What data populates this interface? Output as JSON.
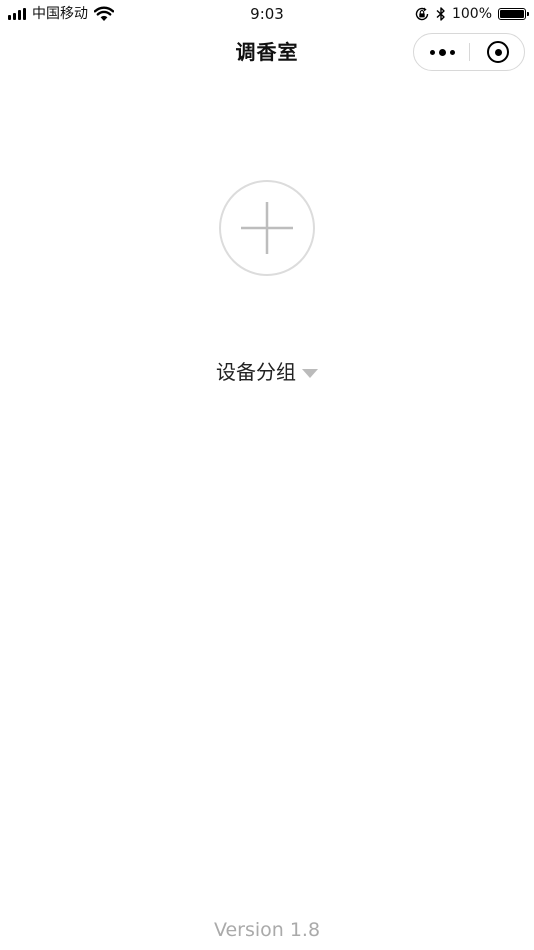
{
  "status_bar": {
    "carrier": "中国移动",
    "time": "9:03",
    "battery_percent": "100%",
    "battery_level": 1.0,
    "icons": [
      "signal-icon",
      "wifi-icon",
      "rotation-lock-icon",
      "bluetooth-icon",
      "battery-icon"
    ]
  },
  "nav": {
    "title": "调香室",
    "menu_icon": "more-dots-icon",
    "close_icon": "miniprogram-close-icon"
  },
  "main": {
    "add_icon": "plus-icon",
    "group_label": "设备分组",
    "group_caret_icon": "caret-down-icon"
  },
  "footer": {
    "version": "Version 1.8"
  },
  "colors": {
    "background": "#ffffff",
    "text": "#111111",
    "muted": "#aaaaaa",
    "border": "#dcdcdc",
    "caret": "#bbbbbb"
  }
}
